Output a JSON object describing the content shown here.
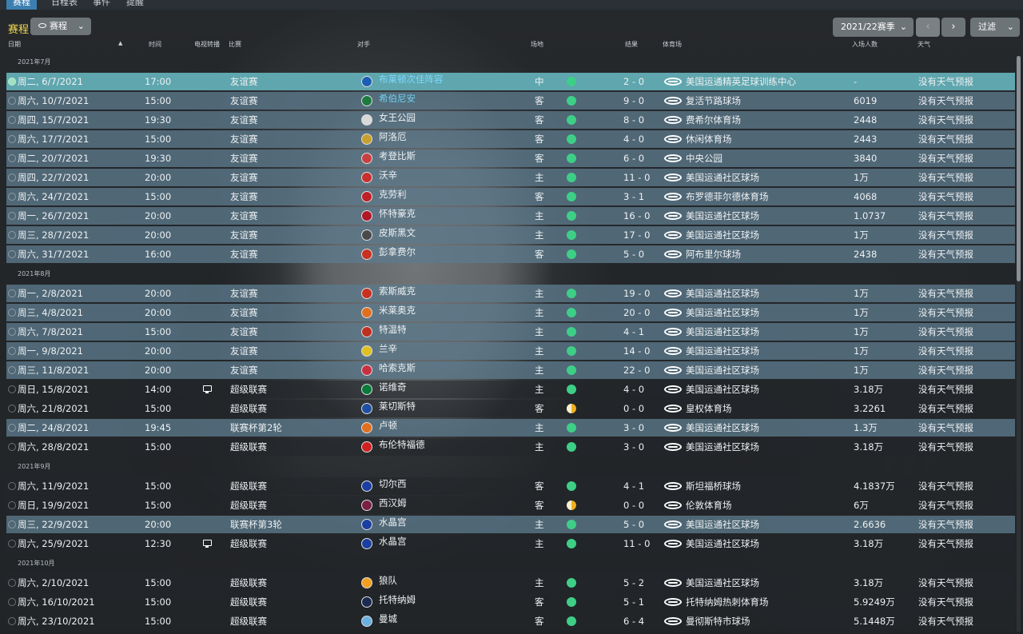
{
  "tabs": [
    "赛程",
    "日程表",
    "事件",
    "提醒"
  ],
  "toolbar": {
    "title": "赛程",
    "view_label": "赛程",
    "season": "2021/22赛季",
    "filter": "过滤"
  },
  "columns": {
    "date": "日期",
    "time": "时间",
    "tv": "电视转播",
    "comp": "比赛",
    "opponent": "对手",
    "venue": "场地",
    "result": "结果",
    "stadium": "体育场",
    "attendance": "入场人数",
    "weather": "天气"
  },
  "months": {
    "jul": "2021年7月",
    "aug": "2021年8月",
    "sep": "2021年9月",
    "oct": "2021年10月"
  },
  "rows": [
    {
      "date": "周二, 6/7/2021",
      "time": "17:00",
      "tv": "",
      "comp": "友谊赛",
      "opp": "布莱顿次佳阵容",
      "venue": "中",
      "result": "win",
      "score": "2 - 0",
      "stadium": "美国运通精英足球训练中心",
      "att": "-",
      "wx": "没有天气预报"
    },
    {
      "date": "周六, 10/7/2021",
      "time": "15:00",
      "tv": "",
      "comp": "友谊赛",
      "opp": "希伯尼安",
      "venue": "客",
      "result": "win",
      "score": "9 - 0",
      "stadium": "复活节路球场",
      "att": "6019",
      "wx": "没有天气预报"
    },
    {
      "date": "周四, 15/7/2021",
      "time": "19:30",
      "tv": "",
      "comp": "友谊赛",
      "opp": "女王公园",
      "venue": "客",
      "result": "win",
      "score": "8 - 0",
      "stadium": "费希尔体育场",
      "att": "2448",
      "wx": "没有天气预报"
    },
    {
      "date": "周六, 17/7/2021",
      "time": "15:00",
      "tv": "",
      "comp": "友谊赛",
      "opp": "阿洛厄",
      "venue": "客",
      "result": "win",
      "score": "4 - 0",
      "stadium": "休闲体育场",
      "att": "2443",
      "wx": "没有天气预报"
    },
    {
      "date": "周二, 20/7/2021",
      "time": "19:30",
      "tv": "",
      "comp": "友谊赛",
      "opp": "考登比斯",
      "venue": "客",
      "result": "win",
      "score": "6 - 0",
      "stadium": "中央公园",
      "att": "3840",
      "wx": "没有天气预报"
    },
    {
      "date": "周四, 22/7/2021",
      "time": "20:00",
      "tv": "",
      "comp": "友谊赛",
      "opp": "沃辛",
      "venue": "主",
      "result": "win",
      "score": "11 - 0",
      "stadium": "美国运通社区球场",
      "att": "1万",
      "wx": "没有天气预报"
    },
    {
      "date": "周六, 24/7/2021",
      "time": "15:00",
      "tv": "",
      "comp": "友谊赛",
      "opp": "克劳利",
      "venue": "客",
      "result": "win",
      "score": "3 - 1",
      "stadium": "布罗德菲尔德体育场",
      "att": "4068",
      "wx": "没有天气预报"
    },
    {
      "date": "周一, 26/7/2021",
      "time": "20:00",
      "tv": "",
      "comp": "友谊赛",
      "opp": "怀特豪克",
      "venue": "主",
      "result": "win",
      "score": "16 - 0",
      "stadium": "美国运通社区球场",
      "att": "1.0737",
      "wx": "没有天气预报"
    },
    {
      "date": "周三, 28/7/2021",
      "time": "20:00",
      "tv": "",
      "comp": "友谊赛",
      "opp": "皮斯黑文",
      "venue": "主",
      "result": "win",
      "score": "17 - 0",
      "stadium": "美国运通社区球场",
      "att": "1万",
      "wx": "没有天气预报"
    },
    {
      "date": "周六, 31/7/2021",
      "time": "16:00",
      "tv": "",
      "comp": "友谊赛",
      "opp": "彭拿费尔",
      "venue": "客",
      "result": "win",
      "score": "5 - 0",
      "stadium": "阿布里尔球场",
      "att": "2438",
      "wx": "没有天气预报"
    },
    {
      "date": "周一, 2/8/2021",
      "time": "20:00",
      "tv": "",
      "comp": "友谊赛",
      "opp": "索斯威克",
      "venue": "主",
      "result": "win",
      "score": "19 - 0",
      "stadium": "美国运通社区球场",
      "att": "1万",
      "wx": "没有天气预报"
    },
    {
      "date": "周三, 4/8/2021",
      "time": "20:00",
      "tv": "",
      "comp": "友谊赛",
      "opp": "米莱奥克",
      "venue": "主",
      "result": "win",
      "score": "20 - 0",
      "stadium": "美国运通社区球场",
      "att": "1万",
      "wx": "没有天气预报"
    },
    {
      "date": "周六, 7/8/2021",
      "time": "15:00",
      "tv": "",
      "comp": "友谊赛",
      "opp": "特温特",
      "venue": "主",
      "result": "win",
      "score": "4 - 1",
      "stadium": "美国运通社区球场",
      "att": "1万",
      "wx": "没有天气预报"
    },
    {
      "date": "周一, 9/8/2021",
      "time": "20:00",
      "tv": "",
      "comp": "友谊赛",
      "opp": "兰辛",
      "venue": "主",
      "result": "win",
      "score": "14 - 0",
      "stadium": "美国运通社区球场",
      "att": "1万",
      "wx": "没有天气预报"
    },
    {
      "date": "周三, 11/8/2021",
      "time": "20:00",
      "tv": "",
      "comp": "友谊赛",
      "opp": "哈索克斯",
      "venue": "主",
      "result": "win",
      "score": "22 - 0",
      "stadium": "美国运通社区球场",
      "att": "1万",
      "wx": "没有天气预报"
    },
    {
      "date": "周日, 15/8/2021",
      "time": "14:00",
      "tv": "tv",
      "comp": "超级联赛",
      "opp": "诺维奇",
      "venue": "主",
      "result": "win",
      "score": "4 - 0",
      "stadium": "美国运通社区球场",
      "att": "3.18万",
      "wx": "没有天气预报"
    },
    {
      "date": "周六, 21/8/2021",
      "time": "15:00",
      "tv": "",
      "comp": "超级联赛",
      "opp": "莱切斯特",
      "venue": "客",
      "result": "draw",
      "score": "0 - 0",
      "stadium": "皇权体育场",
      "att": "3.2261",
      "wx": "没有天气预报"
    },
    {
      "date": "周二, 24/8/2021",
      "time": "19:45",
      "tv": "",
      "comp": "联赛杯第2轮",
      "opp": "卢顿",
      "venue": "主",
      "result": "win",
      "score": "3 - 0",
      "stadium": "美国运通社区球场",
      "att": "1.3万",
      "wx": "没有天气预报"
    },
    {
      "date": "周六, 28/8/2021",
      "time": "15:00",
      "tv": "",
      "comp": "超级联赛",
      "opp": "布伦特福德",
      "venue": "主",
      "result": "win",
      "score": "3 - 0",
      "stadium": "美国运通社区球场",
      "att": "3.18万",
      "wx": "没有天气预报"
    },
    {
      "date": "周六, 11/9/2021",
      "time": "15:00",
      "tv": "",
      "comp": "超级联赛",
      "opp": "切尔西",
      "venue": "客",
      "result": "win",
      "score": "4 - 1",
      "stadium": "斯坦福桥球场",
      "att": "4.1837万",
      "wx": "没有天气预报"
    },
    {
      "date": "周日, 19/9/2021",
      "time": "15:00",
      "tv": "",
      "comp": "超级联赛",
      "opp": "西汉姆",
      "venue": "客",
      "result": "draw",
      "score": "0 - 0",
      "stadium": "伦敦体育场",
      "att": "6万",
      "wx": "没有天气预报"
    },
    {
      "date": "周三, 22/9/2021",
      "time": "20:00",
      "tv": "",
      "comp": "联赛杯第3轮",
      "opp": "水晶宫",
      "venue": "主",
      "result": "win",
      "score": "5 - 0",
      "stadium": "美国运通社区球场",
      "att": "2.6636",
      "wx": "没有天气预报"
    },
    {
      "date": "周六, 25/9/2021",
      "time": "12:30",
      "tv": "tv",
      "comp": "超级联赛",
      "opp": "水晶宫",
      "venue": "主",
      "result": "win",
      "score": "11 - 0",
      "stadium": "美国运通社区球场",
      "att": "3.18万",
      "wx": "没有天气预报"
    },
    {
      "date": "周六, 2/10/2021",
      "time": "15:00",
      "tv": "",
      "comp": "超级联赛",
      "opp": "狼队",
      "venue": "主",
      "result": "win",
      "score": "5 - 2",
      "stadium": "美国运通社区球场",
      "att": "3.18万",
      "wx": "没有天气预报"
    },
    {
      "date": "周六, 16/10/2021",
      "time": "15:00",
      "tv": "",
      "comp": "超级联赛",
      "opp": "托特纳姆",
      "venue": "客",
      "result": "win",
      "score": "5 - 1",
      "stadium": "托特纳姆热刺体育场",
      "att": "5.9249万",
      "wx": "没有天气预报"
    },
    {
      "date": "周六, 23/10/2021",
      "time": "15:00",
      "tv": "",
      "comp": "超级联赛",
      "opp": "曼城",
      "venue": "客",
      "result": "win",
      "score": "6 - 4",
      "stadium": "曼彻斯特市球场",
      "att": "5.1448万",
      "wx": "没有天气预报"
    }
  ],
  "crest_colors": [
    "#1b5fb5",
    "#1f7a3f",
    "#d8d8d8",
    "#c8a030",
    "#c84040",
    "#c83030",
    "#c02028",
    "#b01828",
    "#4a4a4a",
    "#c83020",
    "#c83020",
    "#e07020",
    "#c03020",
    "#e0c020",
    "#c83040",
    "#0a7a3a",
    "#1f4fa0",
    "#e07020",
    "#d02020",
    "#1a3fa0",
    "#7a2040",
    "#1b3fa0",
    "#1b3fa0",
    "#f0a020",
    "#1a2a50",
    "#6ab0e0"
  ],
  "colors": {
    "win": "#3dcf86",
    "draw": "#f0b020",
    "selected": "#5fa6ae",
    "title": "#f1d84f"
  }
}
